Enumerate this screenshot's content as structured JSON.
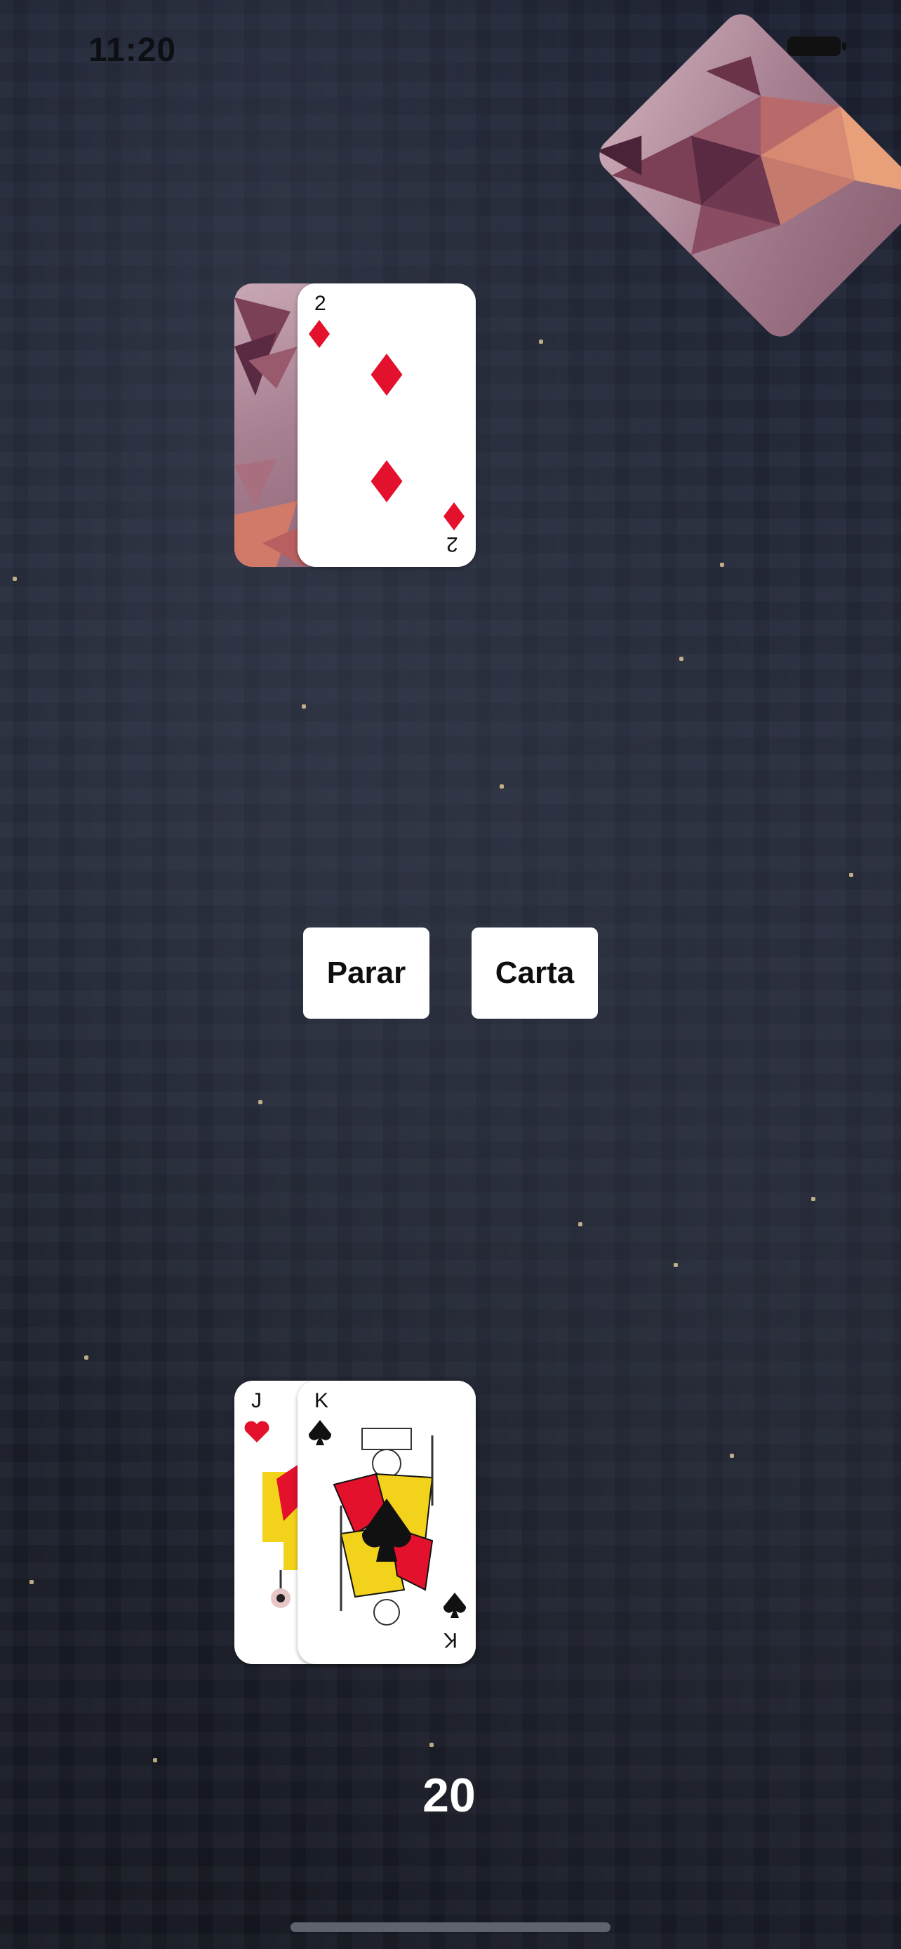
{
  "status_bar": {
    "time": "11:20",
    "icons": [
      "wifi-icon",
      "battery-icon"
    ]
  },
  "deck": {
    "name": "deck-card-back",
    "art": "low-poly-deer"
  },
  "dealer_hand": {
    "cards": [
      {
        "face": "down",
        "art": "low-poly-deer"
      },
      {
        "face": "up",
        "rank": "2",
        "suit": "diamonds",
        "suit_symbol": "♦"
      }
    ]
  },
  "controls": {
    "stand_label": "Parar",
    "hit_label": "Carta"
  },
  "player_hand": {
    "cards": [
      {
        "rank": "J",
        "suit": "hearts",
        "suit_symbol": "♥"
      },
      {
        "rank": "K",
        "suit": "spades",
        "suit_symbol": "♠"
      }
    ],
    "score": "20"
  },
  "colors": {
    "red_suit": "#e3112b",
    "black_suit": "#111111",
    "button_bg": "#ffffff",
    "score_text": "#ffffff"
  }
}
